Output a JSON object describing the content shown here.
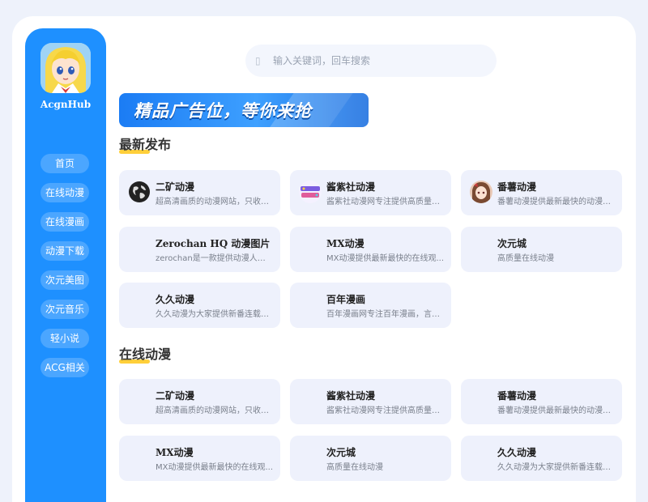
{
  "site": {
    "name": "AcgnHub"
  },
  "nav": {
    "items": [
      "首页",
      "在线动漫",
      "在线漫画",
      "动漫下载",
      "次元美图",
      "次元音乐",
      "轻小说",
      "ACG相关"
    ]
  },
  "search": {
    "placeholder": "输入关键词，回车搜索",
    "icon": "search-icon"
  },
  "ad": {
    "text": "精品广告位，等你来抢"
  },
  "sections": [
    {
      "title": "最新发布",
      "cards": [
        {
          "title": "二矿动漫",
          "desc": "超高清画质的动漫网站，只收录...",
          "icon": "globe-icon"
        },
        {
          "title": "酱紫社动漫",
          "desc": "酱紫社动漫网专注提供高质量的...",
          "icon": "site-logo-icon"
        },
        {
          "title": "番薯动漫",
          "desc": "番薯动漫提供最新最快的动漫新...",
          "icon": "anime-avatar-icon"
        },
        {
          "title": "Zerochan HQ 动漫图片",
          "desc": "zerochan是一款提供动漫人物图...",
          "icon": ""
        },
        {
          "title": "MX动漫",
          "desc": "MX动漫提供最新最快的在线观...",
          "icon": ""
        },
        {
          "title": "次元城",
          "desc": "高质量在线动漫",
          "icon": ""
        },
        {
          "title": "久久动漫",
          "desc": "久久动漫为大家提供新番连载大...",
          "icon": ""
        },
        {
          "title": "百年漫画",
          "desc": "百年漫画网专注百年漫画，言情...",
          "icon": ""
        }
      ]
    },
    {
      "title": "在线动漫",
      "cards": [
        {
          "title": "二矿动漫",
          "desc": "超高清画质的动漫网站，只收录..."
        },
        {
          "title": "酱紫社动漫",
          "desc": "酱紫社动漫网专注提供高质量的..."
        },
        {
          "title": "番薯动漫",
          "desc": "番薯动漫提供最新最快的动漫新..."
        },
        {
          "title": "MX动漫",
          "desc": "MX动漫提供最新最快的在线观..."
        },
        {
          "title": "次元城",
          "desc": "高质量在线动漫"
        },
        {
          "title": "久久动漫",
          "desc": "久久动漫为大家提供新番连载大..."
        }
      ]
    }
  ],
  "colors": {
    "sidebar": "#1e90ff",
    "card": "#eef1fc",
    "accent_bar": "#ffcf3a",
    "page_bg": "#eef2fb"
  }
}
